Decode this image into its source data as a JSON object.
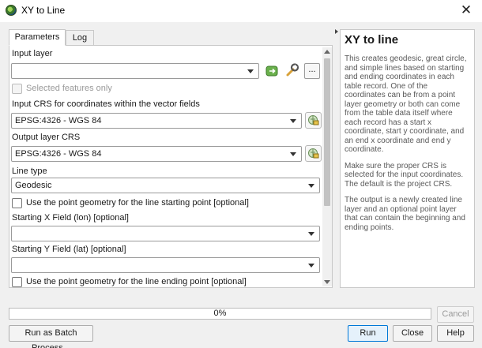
{
  "window": {
    "title": "XY to Line",
    "close_glyph": "✕"
  },
  "tabs": [
    {
      "label": "Parameters"
    },
    {
      "label": "Log"
    }
  ],
  "params": {
    "input_layer_label": "Input layer",
    "input_layer_value": "",
    "selected_only_label": "Selected features only",
    "input_crs_label": "Input CRS for coordinates within the vector fields",
    "input_crs_value": "EPSG:4326 - WGS 84",
    "output_crs_label": "Output layer CRS",
    "output_crs_value": "EPSG:4326 - WGS 84",
    "line_type_label": "Line type",
    "line_type_value": "Geodesic",
    "use_start_geom_label": "Use the point geometry for the line starting point [optional]",
    "start_x_label": "Starting X Field (lon) [optional]",
    "start_x_value": "",
    "start_y_label": "Starting Y Field (lat) [optional]",
    "start_y_value": "",
    "use_end_geom_label": "Use the point geometry for the line ending point [optional]",
    "ellipsis_label": "..."
  },
  "help": {
    "title": "XY to line",
    "paragraphs": [
      "This creates geodesic, great circle, and simple lines based on starting and ending coordinates in each table record. One of the coordinates can be from a point layer geometry or both can come from the table data itself where each record has a start x coordinate, start y coordinate, and an end x coordinate and end y coordinate.",
      "Make sure the proper CRS is selected for the input coordinates. The default is the project CRS.",
      "The output is a newly created line layer and an optional point layer that can contain the beginning and ending points."
    ]
  },
  "progress": {
    "text": "0%",
    "value": 0
  },
  "buttons": {
    "cancel": "Cancel",
    "batch": "Run as Batch Process...",
    "run": "Run",
    "close": "Close",
    "help": "Help"
  },
  "icons": {
    "app": "qgis-logo-icon",
    "iterate": "green-iterate-icon",
    "wrench": "wrench-icon",
    "crs": "crs-globe-icon"
  }
}
